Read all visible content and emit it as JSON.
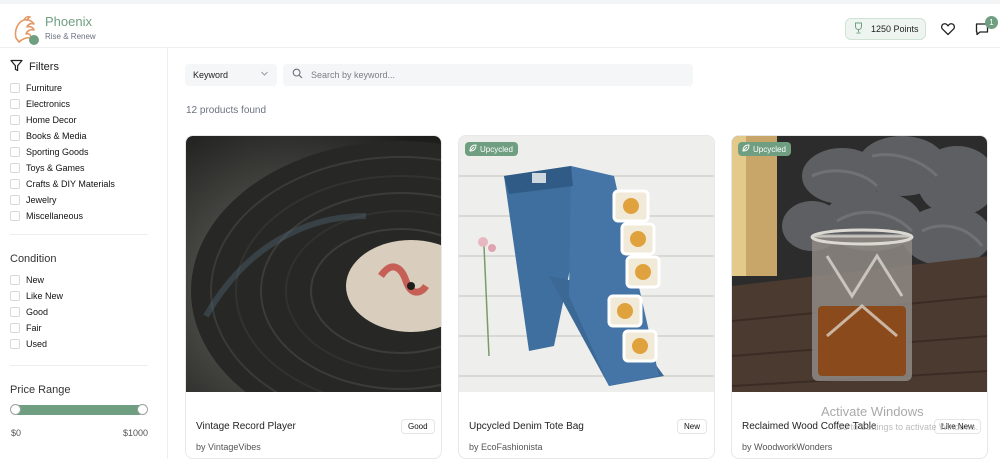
{
  "brand": {
    "name": "Phoenix",
    "tagline": "Rise & Renew",
    "color": "#6f9e80"
  },
  "header": {
    "points": "1250 Points",
    "notification_count": "1",
    "icons": [
      "trophy-icon",
      "heart-icon",
      "chat-icon"
    ]
  },
  "sidebar": {
    "filters_label": "Filters",
    "categories": [
      "Furniture",
      "Electronics",
      "Home Decor",
      "Books & Media",
      "Sporting Goods",
      "Toys & Games",
      "Crafts & DIY Materials",
      "Jewelry",
      "Miscellaneous"
    ],
    "condition_title": "Condition",
    "conditions": [
      "New",
      "Like New",
      "Good",
      "Fair",
      "Used"
    ],
    "price_title": "Price Range",
    "price_min": "$0",
    "price_max": "$1000"
  },
  "search": {
    "type_label": "Keyword",
    "placeholder": "Search by keyword..."
  },
  "results": {
    "count_text": "12 products found"
  },
  "products": [
    {
      "title": "Vintage Record Player",
      "seller": "by VintageVibes",
      "condition": "Good",
      "badge": ""
    },
    {
      "title": "Upcycled Denim Tote Bag",
      "seller": "by EcoFashionista",
      "condition": "New",
      "badge": "Upcycled"
    },
    {
      "title": "Reclaimed Wood Coffee Table",
      "seller": "by WoodworkWonders",
      "condition": "Like New",
      "badge": "Upcycled"
    }
  ],
  "watermark": {
    "line1": "Activate Windows",
    "line2": "Go to Settings to activate Windows."
  }
}
